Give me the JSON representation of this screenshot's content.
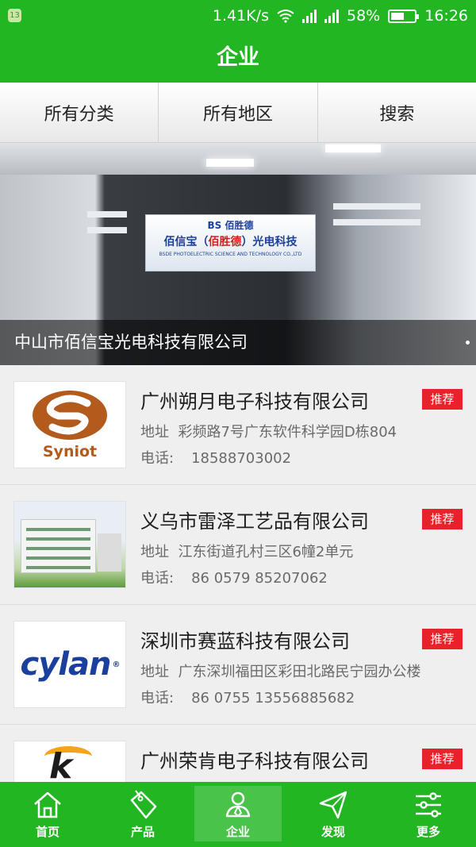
{
  "status": {
    "notification": "13",
    "speed": "1.41K/s",
    "battery": "58%",
    "battery_level": 0.58,
    "time": "16:26"
  },
  "header": {
    "title": "企业"
  },
  "tabs": [
    {
      "label": "所有分类"
    },
    {
      "label": "所有地区"
    },
    {
      "label": "搜索"
    }
  ],
  "banner": {
    "caption": "中山市佰信宝光电科技有限公司",
    "sign": {
      "logo": "BS 佰胜德",
      "cn_before": "佰信宝（",
      "cn_red": "佰胜德",
      "cn_after": "）光电科技",
      "en": "BSDE PHOTOELECTRIC SCIENCE AND TECHNOLOGY CO.,LTD"
    }
  },
  "companies": [
    {
      "name": "广州朔月电子科技有限公司",
      "badge": "推荐",
      "addr_label": "地址",
      "addr": "彩频路7号广东软件科学园D栋804",
      "phone_label": "电话:",
      "phone": "18588703002",
      "logo_text": "Syniot"
    },
    {
      "name": "义乌市雷泽工艺品有限公司",
      "badge": "推荐",
      "addr_label": "地址",
      "addr": "江东街道孔村三区6幢2单元",
      "phone_label": "电话:",
      "phone": "86 0579 85207062"
    },
    {
      "name": "深圳市赛蓝科技有限公司",
      "badge": "推荐",
      "addr_label": "地址",
      "addr": "广东深圳福田区彩田北路民宁园办公楼",
      "phone_label": "电话:",
      "phone": "86 0755 13556885682",
      "logo_text": "cylan"
    },
    {
      "name": "广州荣肯电子科技有限公司",
      "badge": "推荐",
      "logo_text": "k"
    }
  ],
  "nav": [
    {
      "label": "首页",
      "icon": "home-icon"
    },
    {
      "label": "产品",
      "icon": "tag-icon"
    },
    {
      "label": "企业",
      "icon": "company-icon",
      "active": true
    },
    {
      "label": "发现",
      "icon": "paper-plane-icon"
    },
    {
      "label": "更多",
      "icon": "sliders-icon"
    }
  ],
  "colors": {
    "brand_green": "#21b622",
    "badge_red": "#e8222a"
  }
}
